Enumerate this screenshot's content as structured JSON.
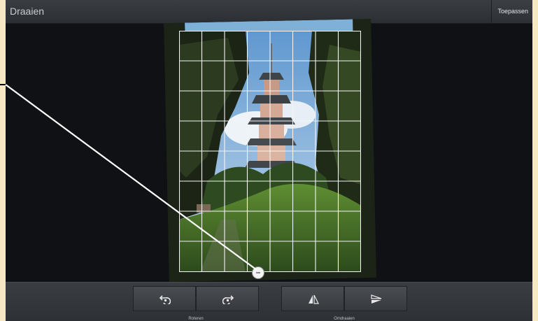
{
  "topbar": {
    "title": "Draaien",
    "apply_label": "Toepassen"
  },
  "toolbar": {
    "rotate_group_label": "Roteren",
    "flip_group_label": "Omdraaien",
    "buttons": [
      {
        "icon": "rotate-left-icon"
      },
      {
        "icon": "rotate-right-icon"
      },
      {
        "icon": "flip-horizontal-icon"
      },
      {
        "icon": "flip-vertical-icon"
      }
    ]
  },
  "colors": {
    "grid": "#f4f4f4",
    "background": "#101215",
    "bar": "#2b2e33"
  }
}
